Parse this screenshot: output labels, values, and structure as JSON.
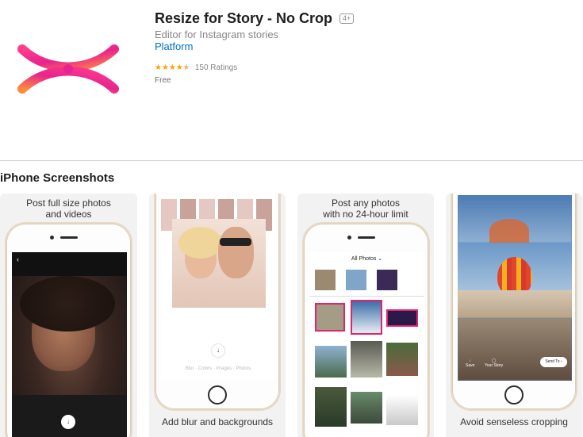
{
  "app": {
    "title": "Resize for Story - No Crop",
    "age_rating": "4+",
    "subtitle": "Editor for Instagram stories",
    "developer": "Platform",
    "stars_filled": 4.5,
    "ratings_text": "150 Ratings",
    "price": "Free",
    "icon": "eye-x-logo-icon",
    "colors": {
      "gradient_start": "#ff3d8b",
      "gradient_mid": "#e8238f",
      "gradient_end": "#ff8a3d",
      "link": "#0070c9",
      "star": "#ff9f0a"
    }
  },
  "screenshots_section": {
    "title": "iPhone Screenshots",
    "items": [
      {
        "caption": "Post full size photos\nand videos",
        "caption_position": "top"
      },
      {
        "caption": "Add blur and backgrounds",
        "caption_position": "bottom",
        "screen": {
          "download_icon": "download-icon"
        }
      },
      {
        "caption": "Post any photos\nwith no 24-hour limit",
        "caption_position": "top",
        "screen": {
          "header": "All Photos"
        }
      },
      {
        "caption": "Avoid senseless cropping",
        "caption_position": "bottom",
        "screen": {
          "send_label": "Send To",
          "save_label": "Save",
          "story_label": "Your Story"
        }
      }
    ]
  }
}
